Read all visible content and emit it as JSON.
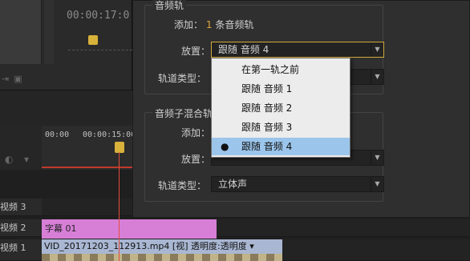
{
  "background": {
    "preview_timecode": "00:00:17:0",
    "timeline_timecodes": [
      "00:00",
      "00:00:15:00"
    ],
    "tracks": [
      {
        "label": "视频 3"
      },
      {
        "label": "视频 2"
      },
      {
        "label": "视频 1"
      }
    ],
    "clip_title": "字幕 01",
    "clip_video": "VID_20171203_112913.mp4 [视] 透明度:透明度 ▾"
  },
  "dialog": {
    "audio_group_title": "音频轨",
    "add_label": "添加：",
    "add_count": "1",
    "add_suffix": "条音频轨",
    "placement_label": "放置：",
    "placement_value": "跟随 音频 4",
    "track_type_label": "轨道类型：",
    "submix_group_title": "音频子混合轨",
    "submix_add_label": "添加：",
    "submix_placement_label": "放置：",
    "submix_track_type_label": "轨道类型：",
    "submix_track_type_value": "立体声"
  },
  "dropdown": {
    "options": [
      {
        "label": "在第一轨之前",
        "selected": false
      },
      {
        "label": "跟随 音频 1",
        "selected": false
      },
      {
        "label": "跟随 音频 2",
        "selected": false
      },
      {
        "label": "跟随 音频 3",
        "selected": false
      },
      {
        "label": "跟随 音频 4",
        "selected": true
      }
    ],
    "bullet": "●"
  },
  "colors": {
    "focus_border": "#d0a83a",
    "selected_option": "#9bc5eb",
    "title_clip": "#d77fd7",
    "video_clip": "#a9b7d2",
    "playhead": "#e74c3c"
  }
}
